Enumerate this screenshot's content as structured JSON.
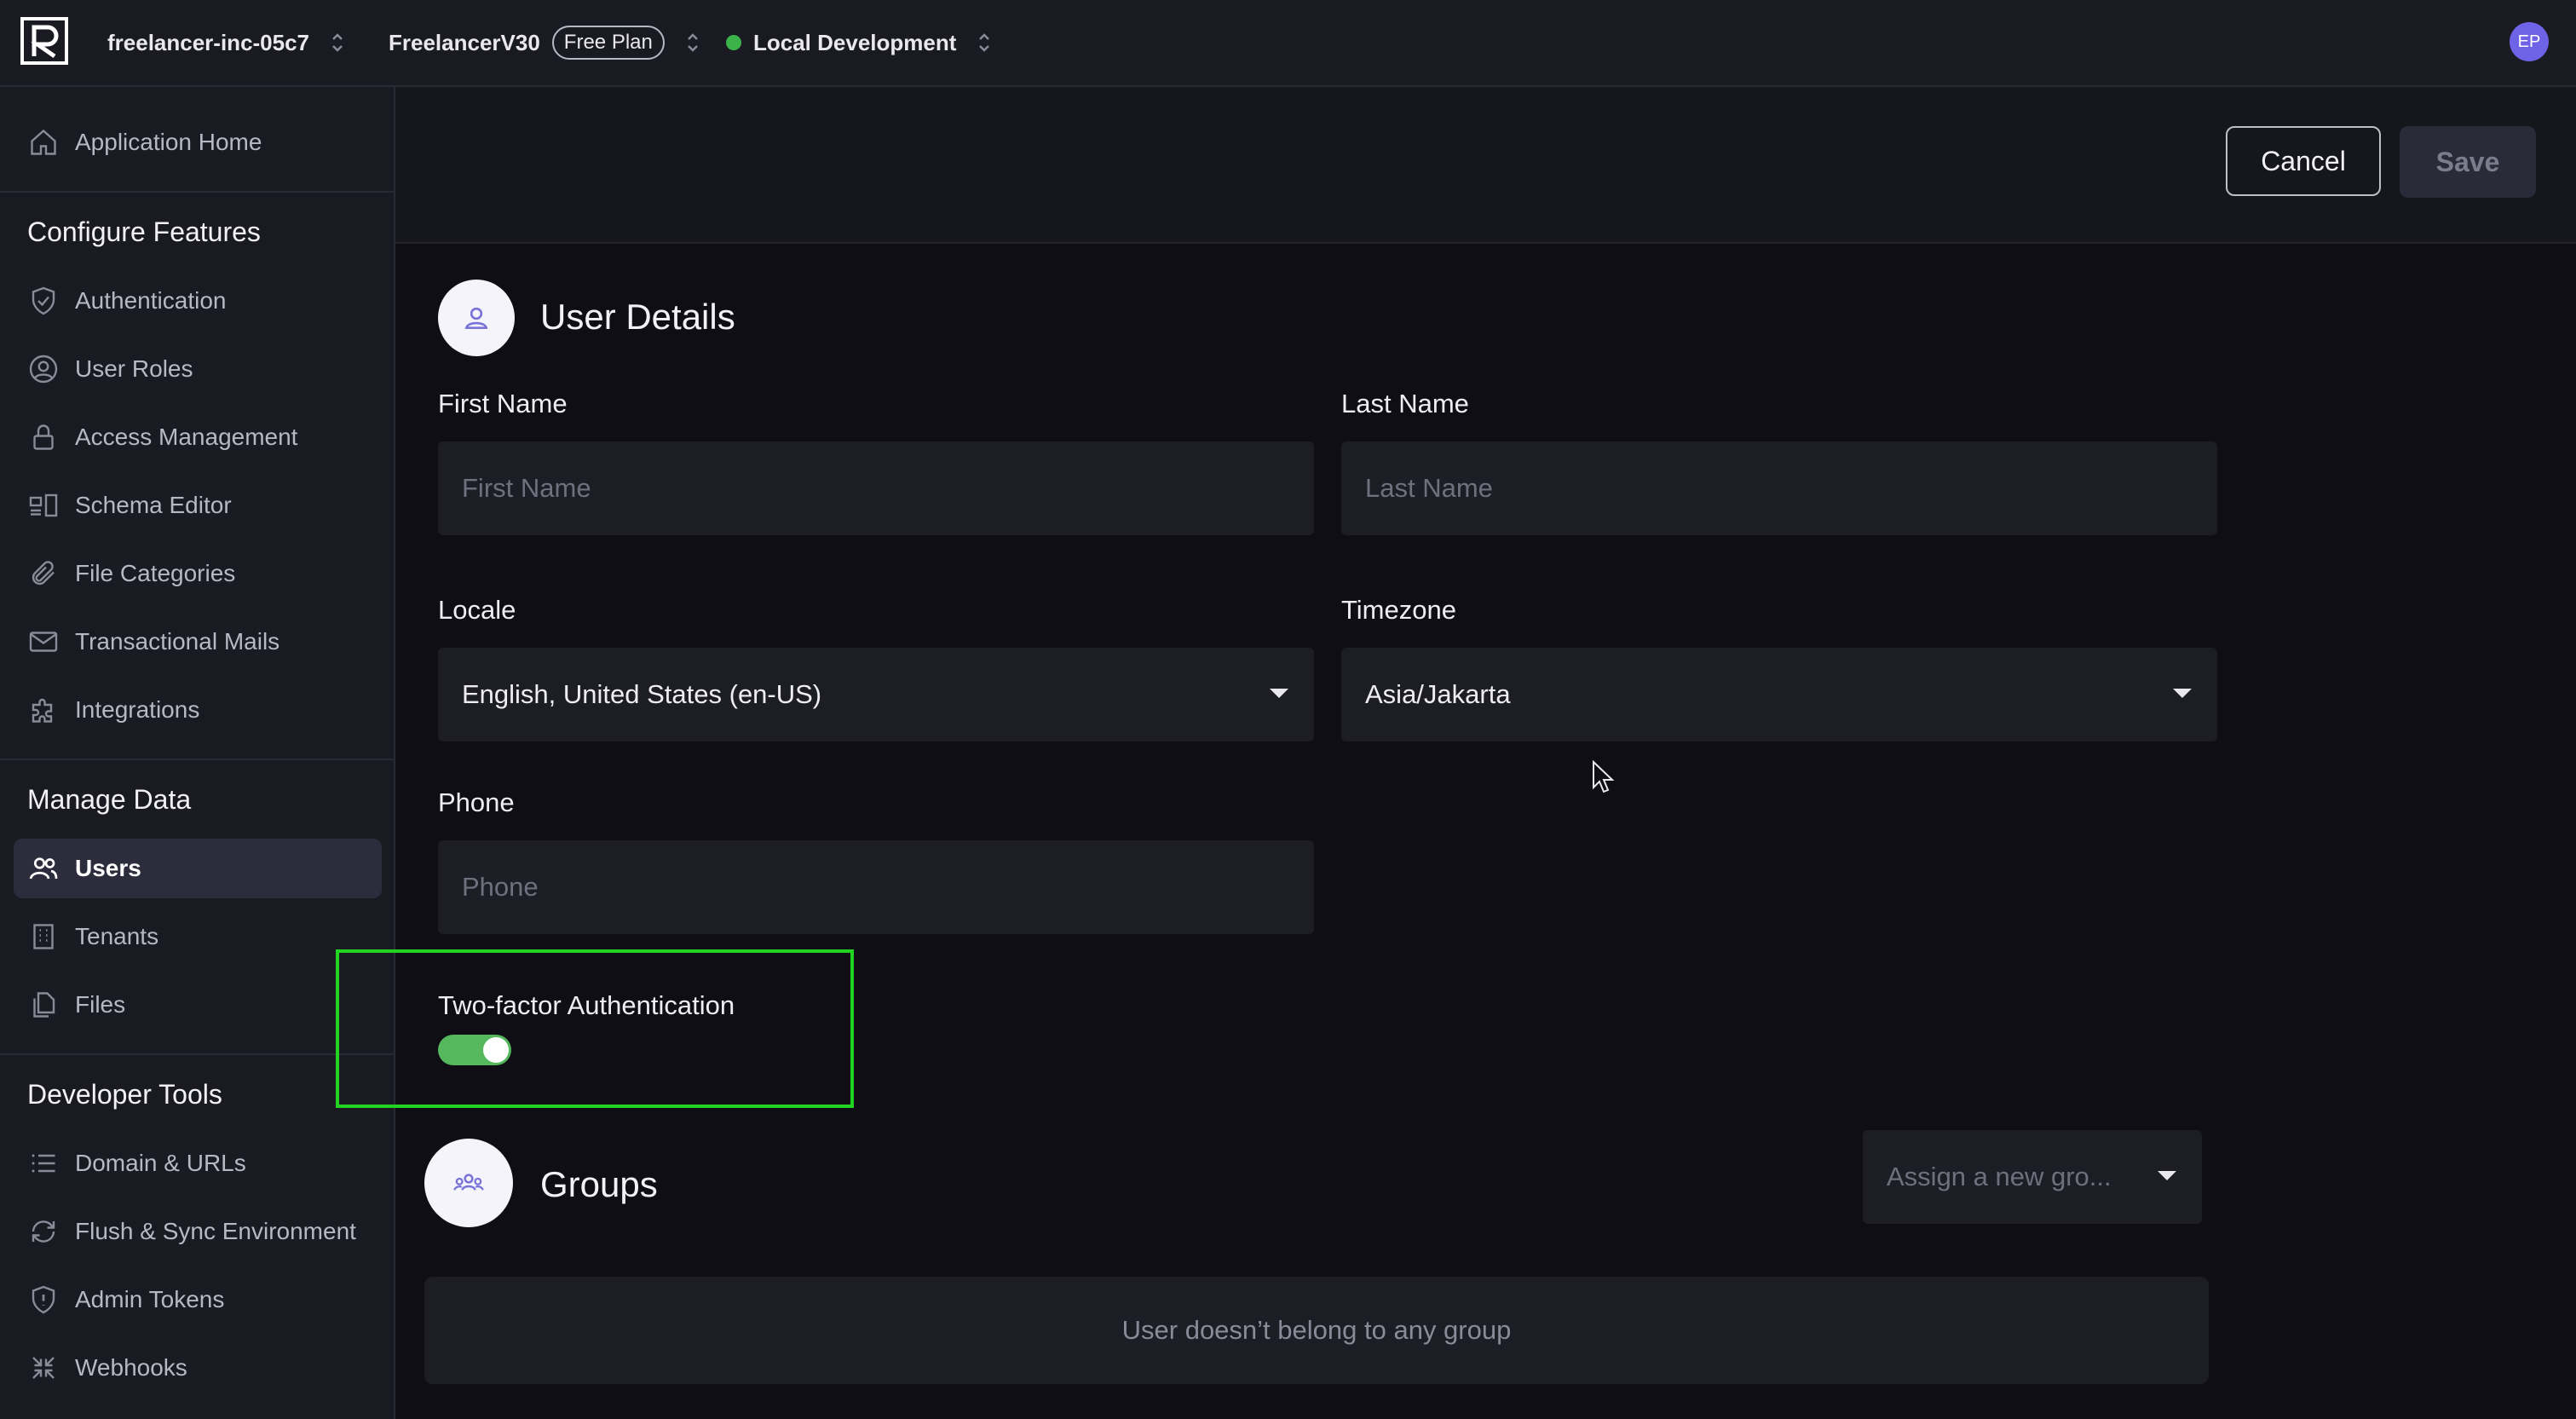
{
  "topbar": {
    "org": "freelancer-inc-05c7",
    "app": "FreelancerV30",
    "plan": "Free Plan",
    "environment": "Local Development",
    "env_status_color": "#3bb34a",
    "avatar": "EP",
    "avatar_color": "#6e63e6"
  },
  "sidebar": {
    "home": {
      "label": "Application Home",
      "icon": "home-icon"
    },
    "sections": [
      {
        "title": "Configure Features",
        "items": [
          {
            "label": "Authentication",
            "icon": "shield-check-icon"
          },
          {
            "label": "User Roles",
            "icon": "user-circle-icon"
          },
          {
            "label": "Access Management",
            "icon": "lock-icon"
          },
          {
            "label": "Schema Editor",
            "icon": "schema-icon"
          },
          {
            "label": "File Categories",
            "icon": "paperclip-icon"
          },
          {
            "label": "Transactional Mails",
            "icon": "mail-icon"
          },
          {
            "label": "Integrations",
            "icon": "puzzle-icon"
          }
        ]
      },
      {
        "title": "Manage Data",
        "items": [
          {
            "label": "Users",
            "icon": "users-icon",
            "active": true
          },
          {
            "label": "Tenants",
            "icon": "building-icon"
          },
          {
            "label": "Files",
            "icon": "files-icon"
          }
        ]
      },
      {
        "title": "Developer Tools",
        "items": [
          {
            "label": "Domain & URLs",
            "icon": "list-icon"
          },
          {
            "label": "Flush & Sync Environment",
            "icon": "refresh-icon"
          },
          {
            "label": "Admin Tokens",
            "icon": "shield-icon"
          },
          {
            "label": "Webhooks",
            "icon": "webhook-icon"
          }
        ]
      }
    ]
  },
  "actions": {
    "cancel": "Cancel",
    "save": "Save"
  },
  "user_details": {
    "title": "User Details",
    "first_name": {
      "label": "First Name",
      "placeholder": "First Name",
      "value": ""
    },
    "last_name": {
      "label": "Last Name",
      "placeholder": "Last Name",
      "value": ""
    },
    "locale": {
      "label": "Locale",
      "value": "English, United States (en-US)"
    },
    "timezone": {
      "label": "Timezone",
      "value": "Asia/Jakarta"
    },
    "phone": {
      "label": "Phone",
      "placeholder": "Phone",
      "value": ""
    },
    "two_factor": {
      "label": "Two-factor Authentication",
      "enabled": true,
      "toggle_color": "#55b85c"
    }
  },
  "groups": {
    "title": "Groups",
    "assign_placeholder": "Assign a new gro...",
    "empty_message": "User doesn’t belong to any group"
  },
  "highlight_color": "#22d322"
}
